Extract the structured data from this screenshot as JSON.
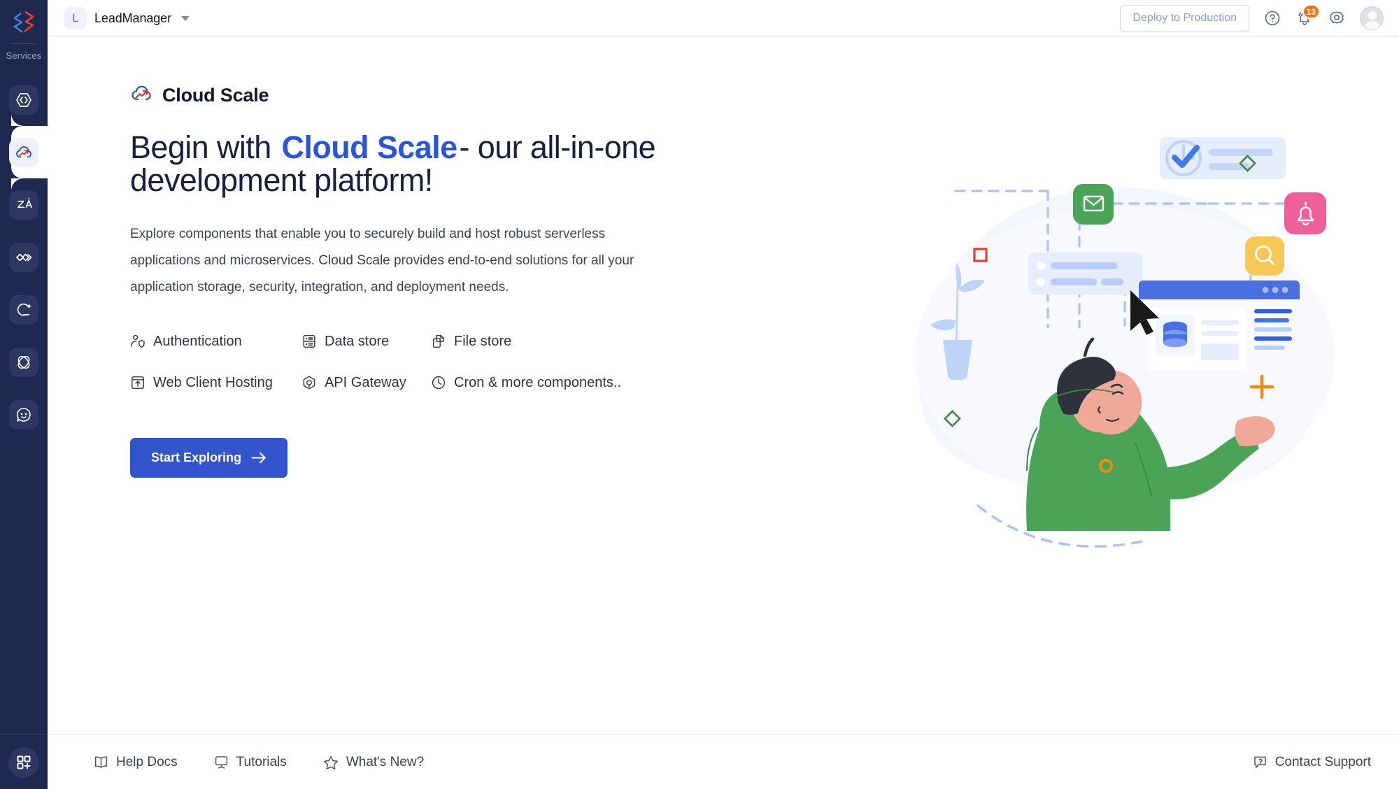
{
  "sidebar": {
    "logo_icon": "catalyst-chevron-logo",
    "services_label": "Services",
    "items": [
      {
        "icon": "code-brackets-icon",
        "name": "sidebar-item-code",
        "active": false
      },
      {
        "icon": "cloud-scale-icon",
        "name": "sidebar-item-cloud-scale",
        "active": true
      },
      {
        "icon": "zia-ai-icon",
        "name": "sidebar-item-zia",
        "active": false
      },
      {
        "icon": "devops-link-icon",
        "name": "sidebar-item-devops",
        "active": false
      },
      {
        "icon": "quickml-sparkle-icon",
        "name": "sidebar-item-quickml",
        "active": false
      },
      {
        "icon": "circuit-loop-icon",
        "name": "sidebar-item-circuit",
        "active": false
      },
      {
        "icon": "chat-bot-icon",
        "name": "sidebar-item-chatbot",
        "active": false
      }
    ],
    "bottom_icon": "grid-plus-icon"
  },
  "header": {
    "project_initial": "L",
    "project_name": "LeadManager",
    "project_dropdown_icon": "chevron-down-icon",
    "deploy_label": "Deploy to Production",
    "help_icon": "question-circle-icon",
    "notifications_icon": "bell-icon",
    "notifications_count": "13",
    "settings_icon": "gear-icon",
    "avatar_icon": "user-avatar"
  },
  "hero": {
    "brand_icon": "cloud-arrow-up-icon",
    "brand_title": "Cloud Scale",
    "headline_before": "Begin with ",
    "headline_highlight": "Cloud Scale",
    "headline_after": "- our all-in-one development platform!",
    "paragraph": "Explore components that enable you to securely build and host robust serverless applications and microservices. Cloud Scale provides end-to-end solutions for all your application storage, security, integration, and deployment needs.",
    "features": [
      {
        "label": "Authentication",
        "icon": "user-shield-icon"
      },
      {
        "label": "Data store",
        "icon": "database-list-icon"
      },
      {
        "label": "File store",
        "icon": "file-copy-icon"
      },
      {
        "label": "Web Client Hosting",
        "icon": "browser-upload-icon"
      },
      {
        "label": "API Gateway",
        "icon": "api-hexagon-icon"
      },
      {
        "label": "Cron & more components..",
        "icon": "clock-icon"
      }
    ],
    "cta_label": "Start Exploring",
    "cta_icon": "arrow-right-icon"
  },
  "footer": {
    "links": [
      {
        "label": "Help Docs",
        "icon": "book-icon"
      },
      {
        "label": "Tutorials",
        "icon": "presentation-board-icon"
      },
      {
        "label": "What's New?",
        "icon": "star-icon"
      }
    ],
    "support": {
      "label": "Contact Support",
      "icon": "chat-question-icon"
    }
  },
  "colors": {
    "sidebar_bg": "#1e2851",
    "accent_blue": "#3355cc",
    "highlight_yellow": "#f5d44f",
    "badge_orange": "#f2711c",
    "illustration_green": "#4ba357",
    "illustration_pink": "#ef5f9b",
    "illustration_amber": "#f7c košice"
  }
}
